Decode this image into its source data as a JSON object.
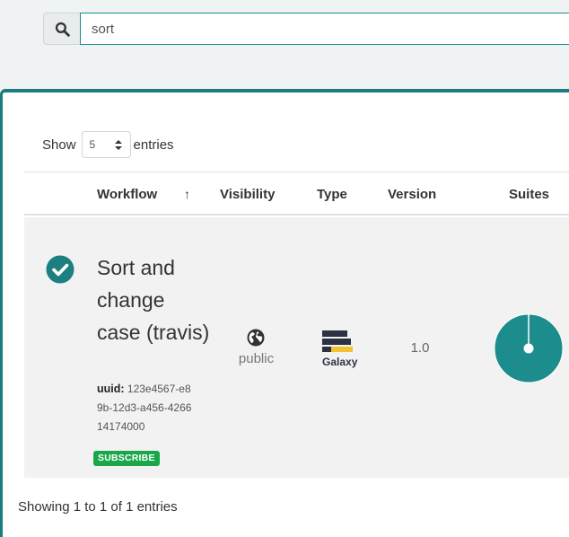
{
  "search": {
    "value": "sort",
    "icon": "search-icon"
  },
  "length": {
    "prefix": "Show",
    "selected": "5",
    "suffix": "entries"
  },
  "table": {
    "columns": [
      "Workflow",
      "Visibility",
      "Type",
      "Version",
      "Suites"
    ],
    "sort_indicator": "↑",
    "rows": [
      {
        "status_icon": "check-circle-icon",
        "name": "Sort and change case (travis)",
        "uuid_label": "uuid:",
        "uuid": "123e4567-e89b-12d3-a456-426614174000",
        "subscribe_label": "SUBSCRIBE",
        "visibility_icon": "globe-icon",
        "visibility": "public",
        "type_icon": "galaxy-logo",
        "type_logo_text": "Galaxy",
        "version": "1.0",
        "suites_icon": "suite-chart-icon"
      }
    ]
  },
  "footer": {
    "info": "Showing 1 to 1 of 1 entries"
  },
  "colors": {
    "accent": "#1c7d7d",
    "success": "#1aa74a",
    "suite_fill": "#1c8c8c"
  }
}
